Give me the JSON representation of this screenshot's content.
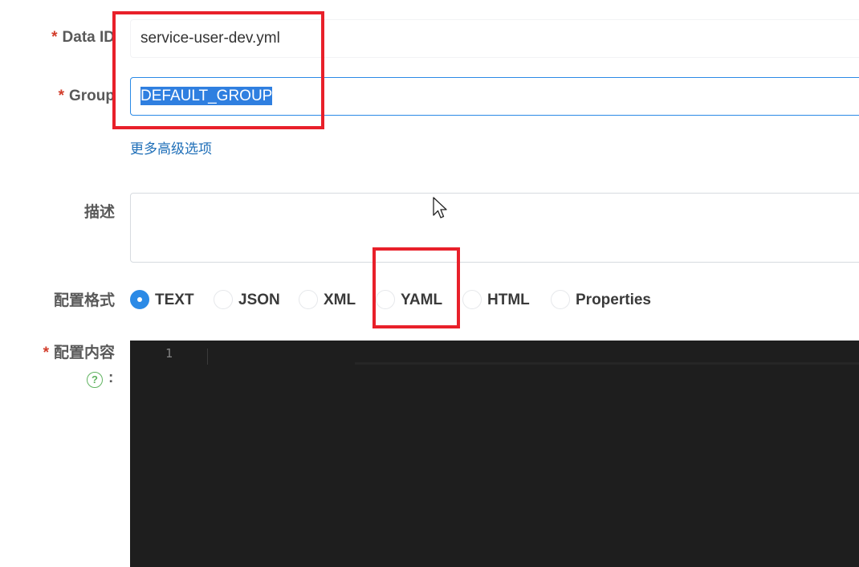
{
  "form": {
    "data_id": {
      "required_mark": "*",
      "label": "Data ID",
      "value": "service-user-dev.yml"
    },
    "group": {
      "required_mark": "*",
      "label": "Group",
      "value": "DEFAULT_GROUP",
      "selected": true
    },
    "advanced_link": "更多高级选项",
    "description": {
      "label": "描述",
      "value": ""
    },
    "format": {
      "label": "配置格式",
      "options": [
        "TEXT",
        "JSON",
        "XML",
        "YAML",
        "HTML",
        "Properties"
      ],
      "selected": "TEXT"
    },
    "content": {
      "required_mark": "*",
      "label": "配置内容",
      "help_icon": "question-circle-icon",
      "help_symbol": "?",
      "colon": ":",
      "line_numbers": [
        "1"
      ]
    }
  },
  "annotations": {
    "highlight_color": "#e8202a"
  },
  "colors": {
    "accent": "#2b8ae6",
    "link": "#1f6fb8",
    "required": "#d23c2a",
    "editor_bg": "#1e1e1e"
  }
}
